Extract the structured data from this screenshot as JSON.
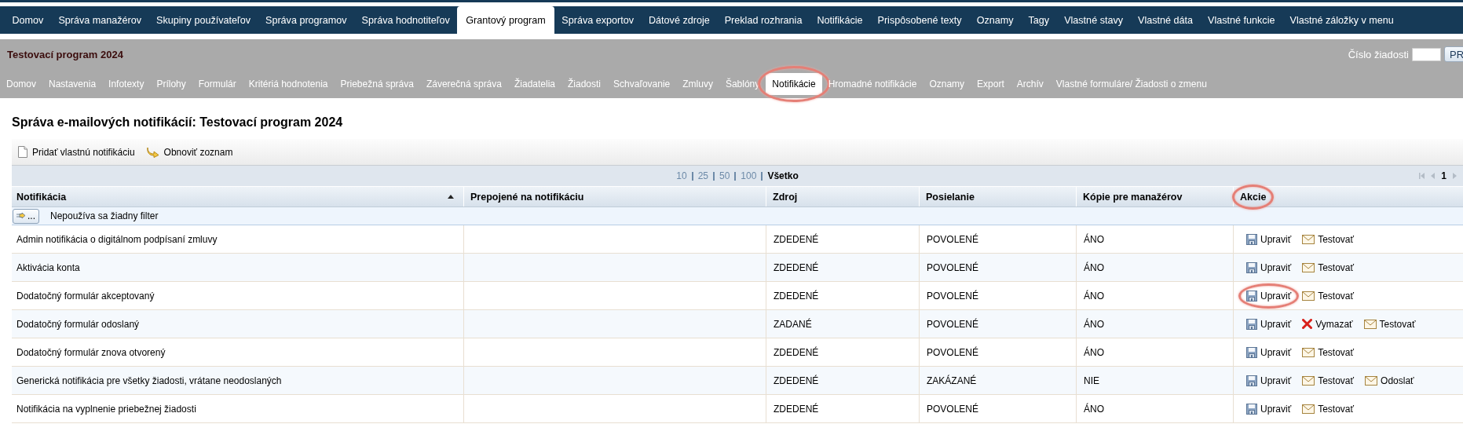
{
  "top_nav": [
    {
      "label": "Domov",
      "selected": false
    },
    {
      "label": "Správa manažérov",
      "selected": false
    },
    {
      "label": "Skupiny používateľov",
      "selected": false
    },
    {
      "label": "Správa programov",
      "selected": false
    },
    {
      "label": "Správa hodnotiteľov",
      "selected": false
    },
    {
      "label": "Grantový program",
      "selected": true
    },
    {
      "label": "Správa exportov",
      "selected": false
    },
    {
      "label": "Dátové zdroje",
      "selected": false
    },
    {
      "label": "Preklad rozhrania",
      "selected": false
    },
    {
      "label": "Notifikácie",
      "selected": false
    },
    {
      "label": "Prispôsobené texty",
      "selected": false
    },
    {
      "label": "Oznamy",
      "selected": false
    },
    {
      "label": "Tagy",
      "selected": false
    },
    {
      "label": "Vlastné stavy",
      "selected": false
    },
    {
      "label": "Vlastné dáta",
      "selected": false
    },
    {
      "label": "Vlastné funkcie",
      "selected": false
    },
    {
      "label": "Vlastné záložky v menu",
      "selected": false
    }
  ],
  "program_bar": {
    "title": "Testovací program 2024",
    "request_label": "Číslo žiadosti",
    "request_button": "PR"
  },
  "sub_nav": [
    {
      "label": "Domov",
      "selected": false,
      "circled": false
    },
    {
      "label": "Nastavenia",
      "selected": false,
      "circled": false
    },
    {
      "label": "Infotexty",
      "selected": false,
      "circled": false
    },
    {
      "label": "Prílohy",
      "selected": false,
      "circled": false
    },
    {
      "label": "Formulár",
      "selected": false,
      "circled": false
    },
    {
      "label": "Kritériá hodnotenia",
      "selected": false,
      "circled": false
    },
    {
      "label": "Priebežná správa",
      "selected": false,
      "circled": false
    },
    {
      "label": "Záverečná správa",
      "selected": false,
      "circled": false
    },
    {
      "label": "Žiadatelia",
      "selected": false,
      "circled": false
    },
    {
      "label": "Žiadosti",
      "selected": false,
      "circled": false
    },
    {
      "label": "Schvaľovanie",
      "selected": false,
      "circled": false
    },
    {
      "label": "Zmluvy",
      "selected": false,
      "circled": false
    },
    {
      "label": "Šablóny",
      "selected": false,
      "circled": false
    },
    {
      "label": "Notifikácie",
      "selected": true,
      "circled": true
    },
    {
      "label": "Hromadné notifikácie",
      "selected": false,
      "circled": false
    },
    {
      "label": "Oznamy",
      "selected": false,
      "circled": false
    },
    {
      "label": "Export",
      "selected": false,
      "circled": false
    },
    {
      "label": "Archív",
      "selected": false,
      "circled": false
    },
    {
      "label": "Vlastné formuláre/ Žiadosti o zmenu",
      "selected": false,
      "circled": false
    }
  ],
  "heading": "Správa e-mailových notifikácií: Testovací program 2024",
  "toolbar": [
    {
      "kind": "add",
      "label": "Pridať vlastnú notifikáciu"
    },
    {
      "kind": "refresh",
      "label": "Obnoviť zoznam"
    }
  ],
  "pager": {
    "sizes": [
      {
        "label": "10",
        "selected": false
      },
      {
        "label": "25",
        "selected": false
      },
      {
        "label": "50",
        "selected": false
      },
      {
        "label": "100",
        "selected": false
      },
      {
        "label": "Všetko",
        "selected": true
      }
    ],
    "page": "1"
  },
  "table": {
    "columns": [
      {
        "label": "Notifikácia",
        "sorted": true,
        "circled": false
      },
      {
        "label": "Prepojené na notifikáciu",
        "sorted": false,
        "circled": false
      },
      {
        "label": "Zdroj",
        "sorted": false,
        "circled": false
      },
      {
        "label": "Posielanie",
        "sorted": false,
        "circled": false
      },
      {
        "label": "Kópie pre manažérov",
        "sorted": false,
        "circled": false
      },
      {
        "label": "Akcie",
        "sorted": false,
        "circled": true
      }
    ],
    "filter": {
      "button": "...",
      "text": "Nepoužíva sa žiadny filter"
    },
    "rows": [
      {
        "cells": [
          "Admin notifikácia o digitálnom podpísaní zmluvy",
          "",
          "ZDEDENÉ",
          "POVOLENÉ",
          "ÁNO"
        ],
        "actions": [
          {
            "kind": "edit",
            "label": "Upraviť",
            "circled": false
          },
          {
            "kind": "test",
            "label": "Testovať",
            "circled": false
          }
        ]
      },
      {
        "cells": [
          "Aktivácia konta",
          "",
          "ZDEDENÉ",
          "POVOLENÉ",
          "ÁNO"
        ],
        "actions": [
          {
            "kind": "edit",
            "label": "Upraviť",
            "circled": false
          },
          {
            "kind": "test",
            "label": "Testovať",
            "circled": false
          }
        ]
      },
      {
        "cells": [
          "Dodatočný formulár akceptovaný",
          "",
          "ZDEDENÉ",
          "POVOLENÉ",
          "ÁNO"
        ],
        "actions": [
          {
            "kind": "edit",
            "label": "Upraviť",
            "circled": true
          },
          {
            "kind": "test",
            "label": "Testovať",
            "circled": false
          }
        ]
      },
      {
        "cells": [
          "Dodatočný formulár odoslaný",
          "",
          "ZADANÉ",
          "POVOLENÉ",
          "ÁNO"
        ],
        "actions": [
          {
            "kind": "edit",
            "label": "Upraviť",
            "circled": false
          },
          {
            "kind": "delete",
            "label": "Vymazať",
            "circled": false
          },
          {
            "kind": "test",
            "label": "Testovať",
            "circled": false
          }
        ]
      },
      {
        "cells": [
          "Dodatočný formulár znova otvorený",
          "",
          "ZDEDENÉ",
          "POVOLENÉ",
          "ÁNO"
        ],
        "actions": [
          {
            "kind": "edit",
            "label": "Upraviť",
            "circled": false
          },
          {
            "kind": "test",
            "label": "Testovať",
            "circled": false
          }
        ]
      },
      {
        "cells": [
          "Generická notifikácia pre všetky žiadosti, vrátane neodoslaných",
          "",
          "ZDEDENÉ",
          "ZAKÁZANÉ",
          "NIE"
        ],
        "actions": [
          {
            "kind": "edit",
            "label": "Upraviť",
            "circled": false
          },
          {
            "kind": "test",
            "label": "Testovať",
            "circled": false
          },
          {
            "kind": "send",
            "label": "Odoslať",
            "circled": false
          }
        ]
      },
      {
        "cells": [
          "Notifikácia na vyplnenie priebežnej žiadosti",
          "",
          "ZDEDENÉ",
          "POVOLENÉ",
          "ÁNO"
        ],
        "actions": [
          {
            "kind": "edit",
            "label": "Upraviť",
            "circled": false
          },
          {
            "kind": "test",
            "label": "Testovať",
            "circled": false
          }
        ]
      }
    ]
  }
}
